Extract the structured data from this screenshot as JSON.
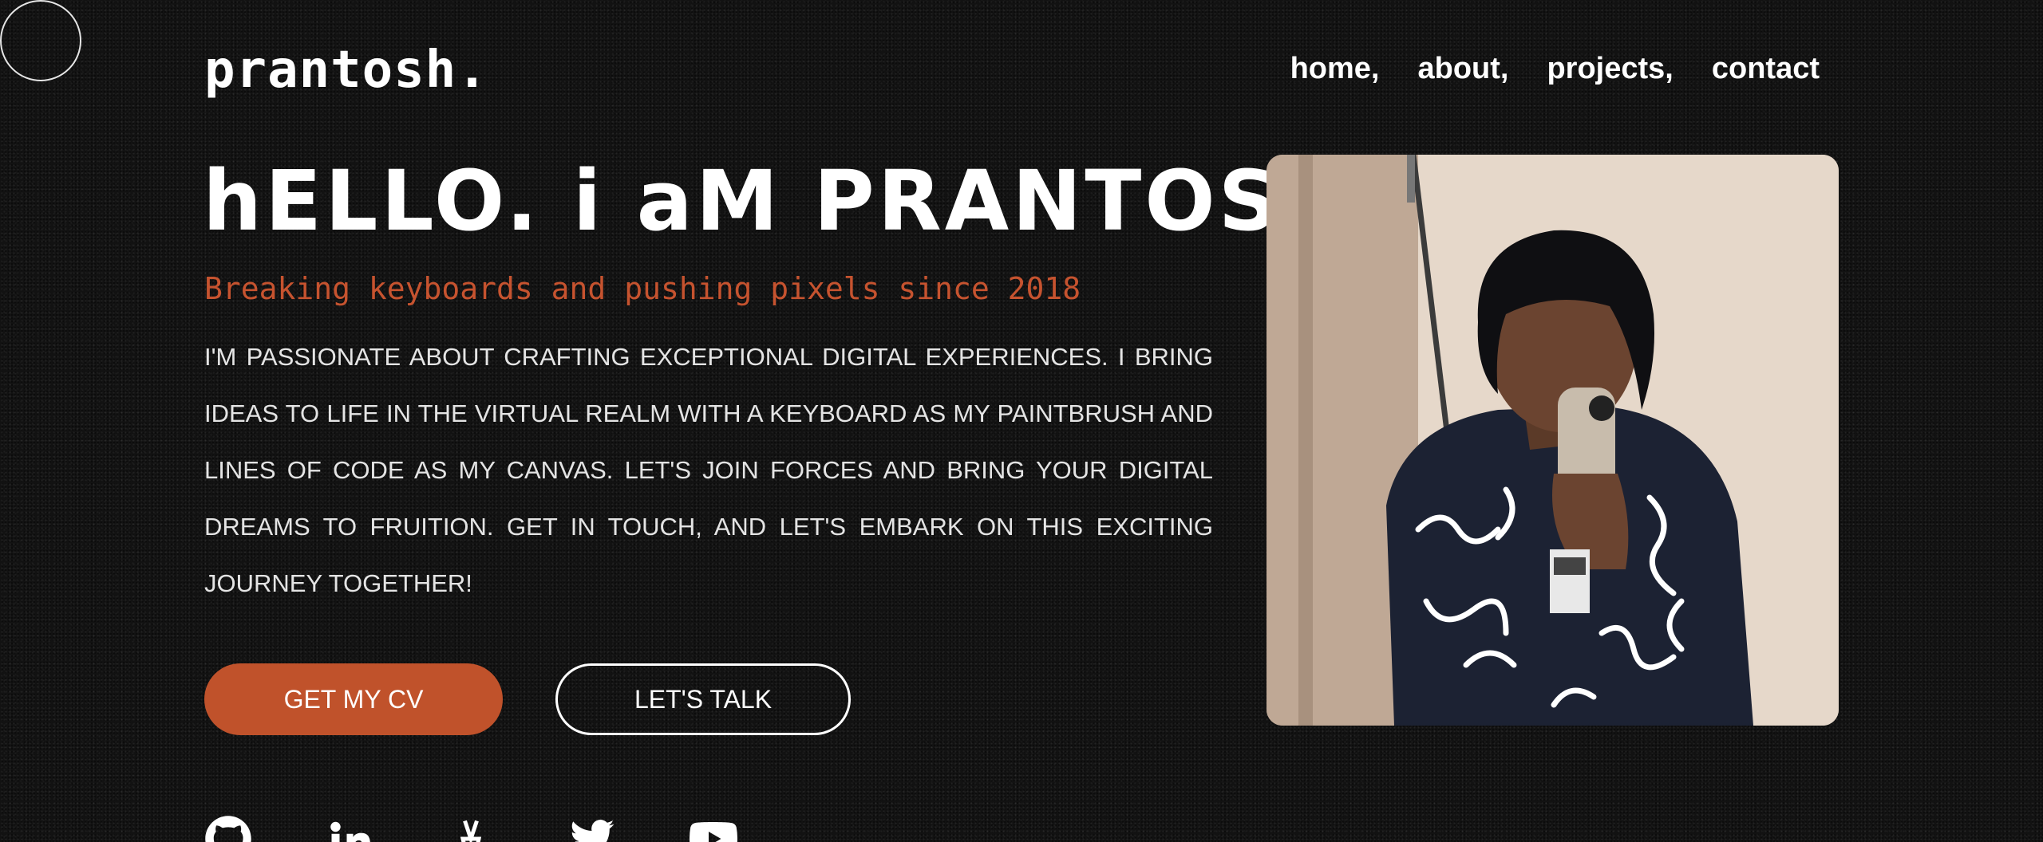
{
  "site": {
    "logo": "prantosh."
  },
  "nav": {
    "items": [
      {
        "label": "home,"
      },
      {
        "label": "about,"
      },
      {
        "label": "projects,"
      },
      {
        "label": "contact"
      }
    ]
  },
  "hero": {
    "title": "hELLO. i aM PRANTOSH",
    "tagline": "Breaking keyboards and pushing pixels since 2018",
    "intro": "I'M PASSIONATE ABOUT CRAFTING EXCEPTIONAL DIGITAL EXPERIENCES. I BRING IDEAS TO LIFE IN THE VIRTUAL REALM WITH A KEYBOARD AS MY PAINTBRUSH AND LINES OF CODE AS MY CANVAS. LET'S JOIN FORCES AND BRING YOUR DIGITAL DREAMS TO FRUITION. GET IN TOUCH, AND LET'S EMBARK ON THIS EXCITING JOURNEY TOGETHER!",
    "cv_button": "GET MY CV",
    "talk_button": "LET'S TALK"
  },
  "socials": [
    {
      "icon": "github-icon"
    },
    {
      "icon": "linkedin-icon"
    },
    {
      "icon": "peerlist-icon"
    },
    {
      "icon": "twitter-icon"
    },
    {
      "icon": "youtube-icon"
    }
  ],
  "colors": {
    "accent": "#c0522b",
    "background": "#121212",
    "text": "#ffffff"
  }
}
